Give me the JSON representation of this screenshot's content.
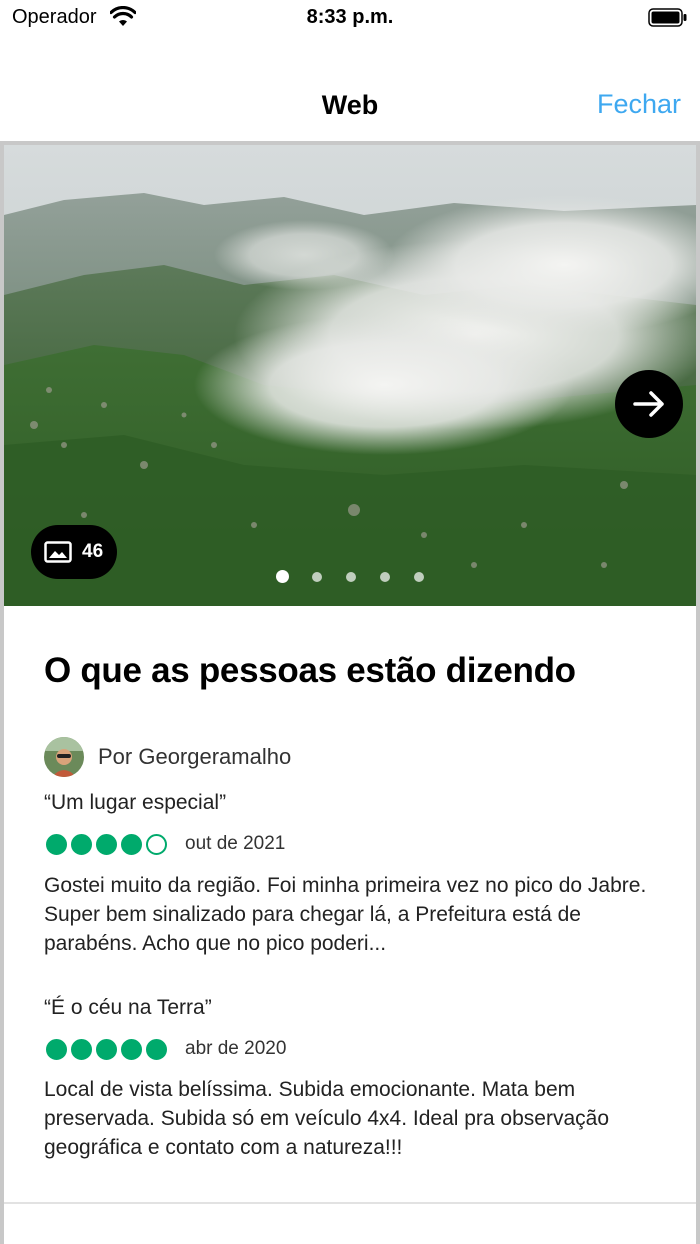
{
  "status_bar": {
    "carrier": "Operador",
    "time": "8:33 p.m."
  },
  "nav": {
    "title": "Web",
    "close_label": "Fechar"
  },
  "hero": {
    "photo_count": "46",
    "dots_total": 5,
    "dots_active_index": 0
  },
  "section": {
    "title": "O que as pessoas estão dizendo"
  },
  "author": {
    "name": "Por Georgeramalho"
  },
  "reviews": [
    {
      "title": "“Um lugar especial”",
      "rating": 4,
      "date": "out de 2021",
      "text": "Gostei muito da região. Foi minha primeira vez no pico do Jabre. Super bem sinalizado para chegar lá, a Prefeitura está de parabéns. Acho que no pico poderi..."
    },
    {
      "title": "“É o céu na Terra”",
      "rating": 5,
      "date": "abr de 2020",
      "text": "Local de vista belíssima. Subida emocionante. Mata bem preservada. Subida só em veículo 4x4. Ideal pra observação geográfica e contato com a natureza!!!"
    }
  ],
  "colors": {
    "accent_link": "#3ea8f0",
    "rating_green": "#00aa6c"
  }
}
